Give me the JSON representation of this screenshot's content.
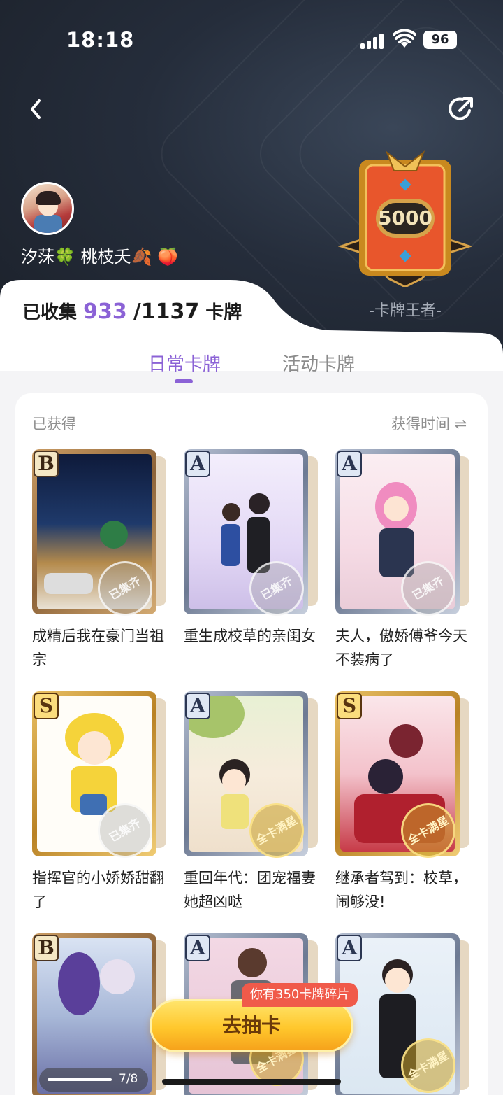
{
  "status_bar": {
    "time": "18:18",
    "battery": "96"
  },
  "profile": {
    "username": "汐莯🍀 桃枝夭🍂 🍑"
  },
  "badge": {
    "number": "5000",
    "title": "-卡牌王者-"
  },
  "collection": {
    "label": "已收集",
    "count": "933",
    "total": "/1137",
    "unit": "卡牌"
  },
  "tabs": [
    {
      "label": "日常卡牌",
      "active": true
    },
    {
      "label": "活动卡牌",
      "active": false
    }
  ],
  "section": {
    "label": "已获得",
    "sort_label": "获得时间 ⇌"
  },
  "cards": [
    {
      "rank": "B",
      "stamp": "已集齐",
      "title": "成精后我在豪门当祖宗"
    },
    {
      "rank": "A",
      "stamp": "已集齐",
      "title": "重生成校草的亲闺女"
    },
    {
      "rank": "A",
      "stamp": "已集齐",
      "title": "夫人，傲娇傅爷今天不装病了"
    },
    {
      "rank": "S",
      "stamp": "已集齐",
      "title": "指挥官的小娇娇甜翻了"
    },
    {
      "rank": "A",
      "stamp": "全卡满星",
      "title": "重回年代：团宠福妻她超凶哒"
    },
    {
      "rank": "S",
      "stamp": "全卡满星",
      "title": "继承者驾到：校草，闹够没!"
    },
    {
      "rank": "B",
      "stamp": "",
      "title": ""
    },
    {
      "rank": "A",
      "stamp": "全卡满星",
      "title": ""
    },
    {
      "rank": "A",
      "stamp": "全卡满星",
      "title": ""
    }
  ],
  "draw": {
    "bubble": "你有350卡牌碎片",
    "button": "去抽卡"
  },
  "pager": {
    "text": "7/8"
  },
  "colors": {
    "accent": "#8b62d6",
    "button": "#ffc72c",
    "bubble": "#f05a4a"
  }
}
